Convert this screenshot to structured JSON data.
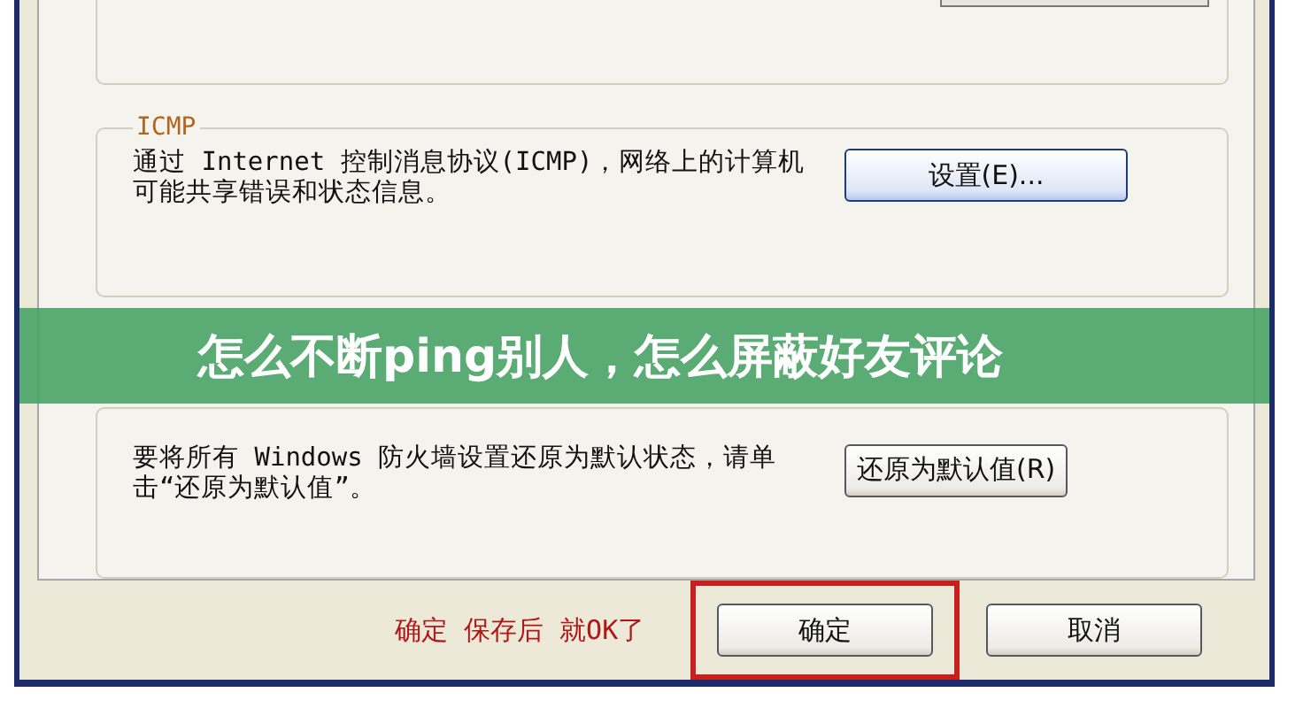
{
  "groups": [
    {
      "label": "ICMP",
      "text": "通过 Internet 控制消息协议(ICMP)，网络上的计算机可能共享错误和状态信息。",
      "button": "设置(E)...",
      "focused": true
    },
    {
      "text": "要将所有 Windows 防火墙设置还原为默认状态，请单击“还原为默认值”。",
      "button": "还原为默认值(R)",
      "focused": false
    }
  ],
  "annotation": "确定 保存后 就OK了",
  "buttons": [
    {
      "label": "确定",
      "highlighted": true
    },
    {
      "label": "取消",
      "highlighted": false
    }
  ],
  "banner": "怎么不断ping别人，怎么屏蔽好友评论"
}
